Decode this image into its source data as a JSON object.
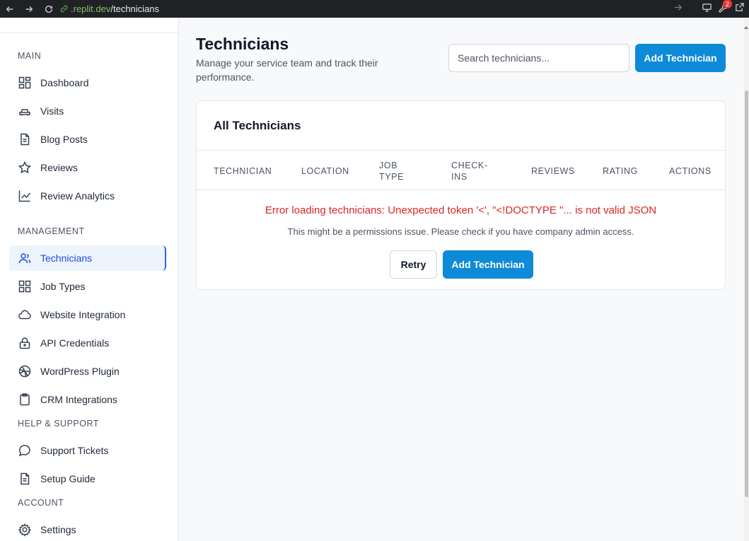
{
  "browser": {
    "url_domain": ".replit.dev",
    "url_path": "/technicians",
    "notification_count": "2"
  },
  "sidebar": {
    "sections": [
      {
        "title": "MAIN"
      },
      {
        "title": "MANAGEMENT"
      },
      {
        "title": "HELP & SUPPORT"
      },
      {
        "title": "ACCOUNT"
      }
    ],
    "items": [
      {
        "label": "Dashboard",
        "icon": "dashboard-grid-icon"
      },
      {
        "label": "Visits",
        "icon": "car-icon"
      },
      {
        "label": "Blog Posts",
        "icon": "document-icon"
      },
      {
        "label": "Reviews",
        "icon": "star-icon"
      },
      {
        "label": "Review Analytics",
        "icon": "line-chart-icon"
      },
      {
        "label": "Technicians",
        "icon": "users-icon",
        "active": true
      },
      {
        "label": "Job Types",
        "icon": "grid-icon"
      },
      {
        "label": "Website Integration",
        "icon": "cloud-icon"
      },
      {
        "label": "API Credentials",
        "icon": "lock-icon"
      },
      {
        "label": "WordPress Plugin",
        "icon": "globe-icon"
      },
      {
        "label": "CRM Integrations",
        "icon": "clipboard-icon"
      },
      {
        "label": "Support Tickets",
        "icon": "message-icon"
      },
      {
        "label": "Setup Guide",
        "icon": "document-icon"
      },
      {
        "label": "Settings",
        "icon": "gear-icon"
      }
    ]
  },
  "header": {
    "title": "Technicians",
    "subtitle": "Manage your service team and track their performance.",
    "search_placeholder": "Search technicians...",
    "add_button": "Add Technician"
  },
  "card": {
    "title": "All Technicians",
    "columns": [
      "TECHNICIAN",
      "LOCATION",
      "JOB TYPE",
      "CHECK-INS",
      "REVIEWS",
      "RATING",
      "ACTIONS"
    ],
    "error_message": "Error loading technicians: Unexpected token '<', \"<!DOCTYPE \"... is not valid JSON",
    "error_hint": "This might be a permissions issue. Please check if you have company admin access.",
    "retry_button": "Retry",
    "add_button": "Add Technician"
  },
  "colors": {
    "primary": "#0d8ad8",
    "error": "#dc2626",
    "active_nav": "#1d4ed8"
  }
}
